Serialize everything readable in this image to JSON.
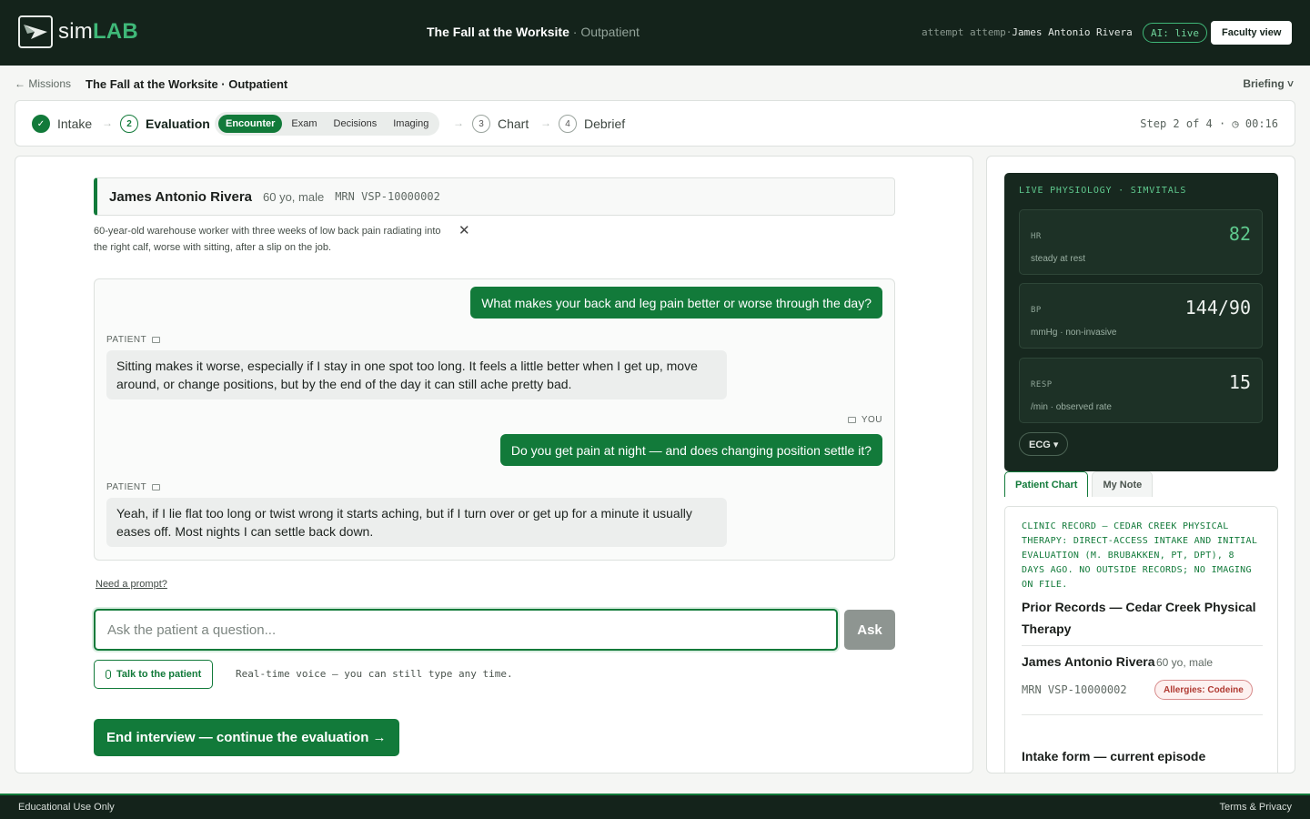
{
  "topbar": {
    "logo_sim": "sim",
    "logo_lab": "LAB",
    "title": "The Fall at the Worksite",
    "title_sub": "· Outpatient",
    "attempt_text": "attempt attemp·",
    "user_name": "James Antonio Rivera",
    "ai_badge": "AI: live",
    "faculty_label": "Faculty view"
  },
  "breadcrumb": {
    "back_label": "← Missions",
    "title": "The Fall at the Worksite · Outpatient",
    "briefing_label": "Briefing ˅"
  },
  "steps": {
    "items": [
      {
        "num": "✓",
        "label": "Intake"
      },
      {
        "num": "2",
        "label": "Evaluation"
      },
      {
        "num": "3",
        "label": "Chart"
      },
      {
        "num": "4",
        "label": "Debrief"
      }
    ],
    "subtabs": [
      "Encounter",
      "Exam",
      "Decisions",
      "Imaging"
    ],
    "arrow": "→",
    "meta": "Step 2 of 4 · ◷ 00:16"
  },
  "patient": {
    "name": "James Antonio Rivera",
    "age_sex": "60 yo, male",
    "mrn": "MRN VSP-10000002",
    "summary": "60-year-old warehouse worker with three weeks of low back pain radiating into the right calf, worse with sitting, after a slip on the job.",
    "close": "✕"
  },
  "chat": {
    "patient_label": "PATIENT",
    "you_label": "YOU",
    "messages": [
      "What makes your back and leg pain better or worse through the day?",
      "Sitting makes it worse, especially if I stay in one spot too long. It feels a little better when I get up, move around, or change positions, but by the end of the day it can still ache pretty bad.",
      "Do you get pain at night — and does changing position settle it?",
      "Yeah, if I lie flat too long or twist wrong it starts aching, but if I turn over or get up for a minute it usually eases off. Most nights I can settle back down."
    ]
  },
  "composer": {
    "need_prompt": "Need a prompt?",
    "placeholder": "Ask the patient a question...",
    "ask_label": "Ask",
    "talk_label": "Talk to the patient",
    "voice_note": "Real-time voice — you can still type any time.",
    "end_label": "End interview — continue the evaluation →"
  },
  "vitals": {
    "title": "LIVE PHYSIOLOGY · SIMVITALS",
    "hr": {
      "label": "HR",
      "value": "82",
      "sub": "steady at rest"
    },
    "bp": {
      "label": "BP",
      "value": "144/90",
      "sub": "mmHg · non-invasive"
    },
    "resp": {
      "label": "RESP",
      "value": "15",
      "sub": "/min · observed rate"
    },
    "ecg_label": "ECG ▾"
  },
  "chart_panel": {
    "tabs": [
      "Patient Chart",
      "My Note"
    ],
    "record_header": "CLINIC RECORD — CEDAR CREEK PHYSICAL THERAPY: DIRECT-ACCESS INTAKE AND INITIAL EVALUATION (M. BRUBAKKEN, PT, DPT), 8 DAYS AGO. NO OUTSIDE RECORDS; NO IMAGING ON FILE.",
    "record_title": "Prior Records — Cedar Creek Physical Therapy",
    "name": "James Antonio Rivera",
    "age_sex": "60 yo, male",
    "mrn": "MRN VSP-10000002",
    "allergies": "Allergies: Codeine",
    "intake_title": "Intake form — current episode"
  },
  "footer": {
    "left": "Educational Use Only",
    "right": "Terms & Privacy"
  },
  "colors": {
    "brand_green": "#127a3a",
    "topbar_bg": "#14231b",
    "vitals_bg": "#17281f",
    "accent_green": "#5fc98e"
  }
}
